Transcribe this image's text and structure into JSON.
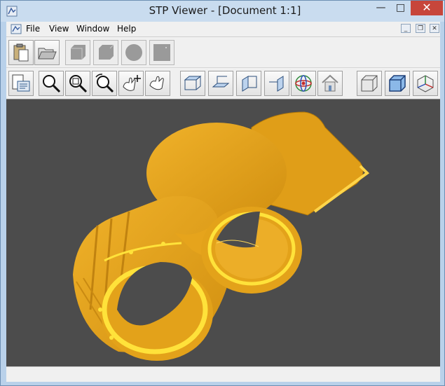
{
  "window": {
    "title": "STP Viewer - [Document 1:1]",
    "controls": {
      "minimize": "—",
      "maximize": "□",
      "close": "✕"
    }
  },
  "menu": {
    "items": [
      "File",
      "View",
      "Window",
      "Help"
    ],
    "mdi_controls": {
      "minimize": "_",
      "restore": "❐",
      "close": "✕"
    }
  },
  "toolbar1": {
    "buttons": [
      {
        "name": "paste-icon",
        "enabled": true
      },
      {
        "name": "open-folder-icon",
        "enabled": true
      },
      {
        "name": "solid-shape-icon",
        "enabled": false
      },
      {
        "name": "wire-shape-icon",
        "enabled": false
      },
      {
        "name": "sphere-shape-icon",
        "enabled": false
      },
      {
        "name": "blank-shape-icon",
        "enabled": false
      }
    ]
  },
  "toolbar2": {
    "buttons": [
      "properties-icon",
      "zoom-icon",
      "zoom-window-icon",
      "rotate-zoom-icon",
      "pan-icon",
      "hand-icon",
      "top-view-icon",
      "bottom-view-icon",
      "front-view-icon",
      "side-view-icon",
      "orbit-icon",
      "home-view-icon",
      "shaded-box-icon",
      "wireframe-box-icon",
      "axes-icon"
    ]
  },
  "viewport": {
    "background": "#4c4c4c",
    "model_color": "#e3a21a",
    "highlight_color": "#ffe23a"
  },
  "status": {
    "text": ""
  }
}
